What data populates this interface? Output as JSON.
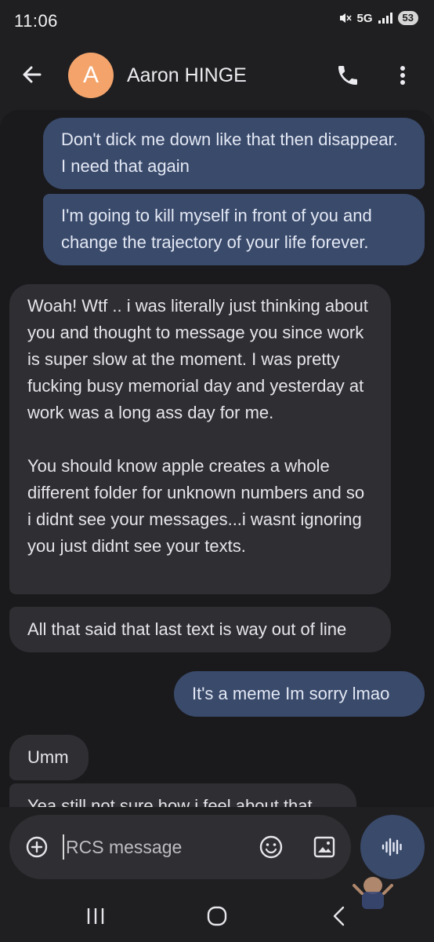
{
  "status_bar": {
    "time": "11:06",
    "network": "5G",
    "battery": "53"
  },
  "header": {
    "avatar_letter": "A",
    "contact_name": "Aaron HINGE"
  },
  "messages": [
    {
      "direction": "outgoing",
      "text": "Don't dick me down like that then disappear. I need that again"
    },
    {
      "direction": "outgoing",
      "text": "I'm going to kill myself in front of you and change the trajectory of your life forever."
    },
    {
      "direction": "incoming",
      "text": "Woah! Wtf .. i was literally just thinking about you and thought to message you since work is super slow at the moment. I was pretty fucking busy memorial day and yesterday at work was a long ass day for me.\n\nYou should know apple creates a whole different folder for unknown numbers and so i didnt see your messages...i wasnt ignoring you just didnt see your texts."
    },
    {
      "direction": "incoming",
      "text": "All that said that last text is way out of line"
    },
    {
      "direction": "outgoing",
      "text": "It's a meme Im sorry lmao"
    },
    {
      "direction": "incoming",
      "text": "Umm"
    },
    {
      "direction": "incoming",
      "text": "Yea still not sure how i feel about that"
    }
  ],
  "compose": {
    "placeholder": "RCS message"
  },
  "colors": {
    "background": "#1f1f22",
    "outgoing_bubble": "#3a4a6b",
    "incoming_bubble": "#2f2f33",
    "avatar": "#f4a46b"
  },
  "icons": [
    "back-arrow-icon",
    "phone-icon",
    "more-vert-icon",
    "add-circle-icon",
    "emoji-icon",
    "gallery-icon",
    "voice-waveform-icon"
  ]
}
